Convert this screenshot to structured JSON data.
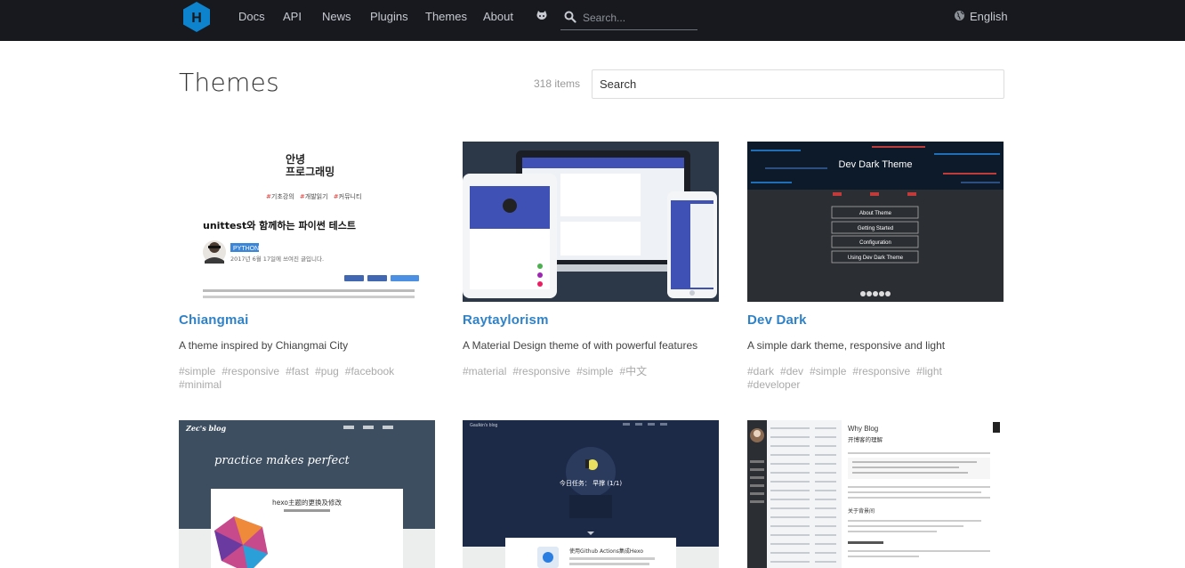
{
  "nav": {
    "items": [
      {
        "label": "Docs"
      },
      {
        "label": "API"
      },
      {
        "label": "News"
      },
      {
        "label": "Plugins"
      },
      {
        "label": "Themes"
      },
      {
        "label": "About"
      }
    ],
    "search_placeholder": "Search...",
    "language": "English"
  },
  "header": {
    "title": "Themes",
    "count": "318 items",
    "search_value": "Search"
  },
  "cards": [
    {
      "name": "Chiangmai",
      "description": "A theme inspired by Chiangmai City",
      "tags": [
        "#simple",
        "#responsive",
        "#fast",
        "#pug",
        "#facebook",
        "#minimal"
      ],
      "preview": {
        "greeting_1": "안녕",
        "greeting_2": "프로그래밍",
        "categories": [
          "기초강의",
          "개발읽기",
          "커뮤니티"
        ],
        "post_title": "unittest와 함께하는 파이썬 테스트",
        "badge": "PYTHON",
        "date": "2017년 6월 17일에 쓰여진 글입니다."
      }
    },
    {
      "name": "Raytaylorism",
      "description": "A Material Design theme of with powerful features",
      "tags": [
        "#material",
        "#responsive",
        "#simple",
        "#中文"
      ]
    },
    {
      "name": "Dev Dark",
      "description": "A simple dark theme, responsive and light",
      "tags": [
        "#dark",
        "#dev",
        "#simple",
        "#responsive",
        "#light",
        "#developer"
      ],
      "preview": {
        "title": "Dev Dark Theme",
        "buttons": [
          "About Theme",
          "Getting Started",
          "Configuration",
          "Using Dev Dark Theme"
        ]
      }
    },
    {
      "preview": {
        "blog": "Zec's blog",
        "tagline": "practice makes perfect",
        "post": "hexo主题的更换及修改"
      }
    },
    {
      "preview": {
        "blog": "Gaulkin's blog",
        "caption": "今日任务：  早撑 (1/1)",
        "post": "使用Github Actions集成Hexo"
      }
    },
    {
      "preview": {
        "title": "Why Blog",
        "subtitle": "开博客的理解",
        "section": "关于背景间"
      }
    }
  ],
  "colors": {
    "topbar": "#17191e",
    "link": "#2f82c8",
    "logo": "#0e83cd"
  }
}
